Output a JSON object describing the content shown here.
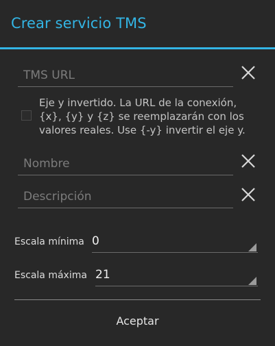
{
  "dialog": {
    "title": "Crear servicio TMS",
    "accent_color": "#33b5e5"
  },
  "form": {
    "url": {
      "value": "",
      "placeholder": "TMS URL",
      "clear_icon": "close-icon"
    },
    "invert_y": {
      "checked": false,
      "text": "Eje y invertido. La URL de la conexión, {x}, {y} y {z} se reemplazarán con los valores reales. Use {-y} invertir el eje y."
    },
    "name": {
      "value": "",
      "placeholder": "Nombre",
      "clear_icon": "close-icon"
    },
    "description": {
      "value": "",
      "placeholder": "Descripción",
      "clear_icon": "close-icon"
    },
    "min_scale": {
      "label": "Escala mínima",
      "value": "0"
    },
    "max_scale": {
      "label": "Escala máxima",
      "value": "21"
    }
  },
  "footer": {
    "accept_label": "Aceptar"
  }
}
